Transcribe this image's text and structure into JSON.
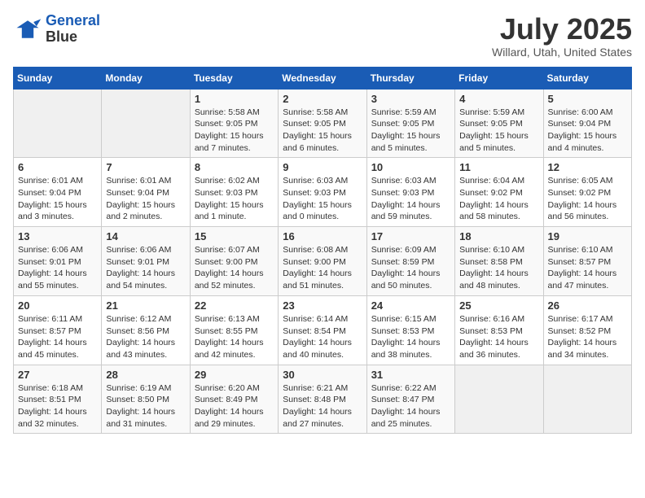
{
  "header": {
    "logo_line1": "General",
    "logo_line2": "Blue",
    "month_year": "July 2025",
    "location": "Willard, Utah, United States"
  },
  "weekdays": [
    "Sunday",
    "Monday",
    "Tuesday",
    "Wednesday",
    "Thursday",
    "Friday",
    "Saturday"
  ],
  "weeks": [
    [
      {
        "day": "",
        "content": ""
      },
      {
        "day": "",
        "content": ""
      },
      {
        "day": "1",
        "content": "Sunrise: 5:58 AM\nSunset: 9:05 PM\nDaylight: 15 hours\nand 7 minutes."
      },
      {
        "day": "2",
        "content": "Sunrise: 5:58 AM\nSunset: 9:05 PM\nDaylight: 15 hours\nand 6 minutes."
      },
      {
        "day": "3",
        "content": "Sunrise: 5:59 AM\nSunset: 9:05 PM\nDaylight: 15 hours\nand 5 minutes."
      },
      {
        "day": "4",
        "content": "Sunrise: 5:59 AM\nSunset: 9:05 PM\nDaylight: 15 hours\nand 5 minutes."
      },
      {
        "day": "5",
        "content": "Sunrise: 6:00 AM\nSunset: 9:04 PM\nDaylight: 15 hours\nand 4 minutes."
      }
    ],
    [
      {
        "day": "6",
        "content": "Sunrise: 6:01 AM\nSunset: 9:04 PM\nDaylight: 15 hours\nand 3 minutes."
      },
      {
        "day": "7",
        "content": "Sunrise: 6:01 AM\nSunset: 9:04 PM\nDaylight: 15 hours\nand 2 minutes."
      },
      {
        "day": "8",
        "content": "Sunrise: 6:02 AM\nSunset: 9:03 PM\nDaylight: 15 hours\nand 1 minute."
      },
      {
        "day": "9",
        "content": "Sunrise: 6:03 AM\nSunset: 9:03 PM\nDaylight: 15 hours\nand 0 minutes."
      },
      {
        "day": "10",
        "content": "Sunrise: 6:03 AM\nSunset: 9:03 PM\nDaylight: 14 hours\nand 59 minutes."
      },
      {
        "day": "11",
        "content": "Sunrise: 6:04 AM\nSunset: 9:02 PM\nDaylight: 14 hours\nand 58 minutes."
      },
      {
        "day": "12",
        "content": "Sunrise: 6:05 AM\nSunset: 9:02 PM\nDaylight: 14 hours\nand 56 minutes."
      }
    ],
    [
      {
        "day": "13",
        "content": "Sunrise: 6:06 AM\nSunset: 9:01 PM\nDaylight: 14 hours\nand 55 minutes."
      },
      {
        "day": "14",
        "content": "Sunrise: 6:06 AM\nSunset: 9:01 PM\nDaylight: 14 hours\nand 54 minutes."
      },
      {
        "day": "15",
        "content": "Sunrise: 6:07 AM\nSunset: 9:00 PM\nDaylight: 14 hours\nand 52 minutes."
      },
      {
        "day": "16",
        "content": "Sunrise: 6:08 AM\nSunset: 9:00 PM\nDaylight: 14 hours\nand 51 minutes."
      },
      {
        "day": "17",
        "content": "Sunrise: 6:09 AM\nSunset: 8:59 PM\nDaylight: 14 hours\nand 50 minutes."
      },
      {
        "day": "18",
        "content": "Sunrise: 6:10 AM\nSunset: 8:58 PM\nDaylight: 14 hours\nand 48 minutes."
      },
      {
        "day": "19",
        "content": "Sunrise: 6:10 AM\nSunset: 8:57 PM\nDaylight: 14 hours\nand 47 minutes."
      }
    ],
    [
      {
        "day": "20",
        "content": "Sunrise: 6:11 AM\nSunset: 8:57 PM\nDaylight: 14 hours\nand 45 minutes."
      },
      {
        "day": "21",
        "content": "Sunrise: 6:12 AM\nSunset: 8:56 PM\nDaylight: 14 hours\nand 43 minutes."
      },
      {
        "day": "22",
        "content": "Sunrise: 6:13 AM\nSunset: 8:55 PM\nDaylight: 14 hours\nand 42 minutes."
      },
      {
        "day": "23",
        "content": "Sunrise: 6:14 AM\nSunset: 8:54 PM\nDaylight: 14 hours\nand 40 minutes."
      },
      {
        "day": "24",
        "content": "Sunrise: 6:15 AM\nSunset: 8:53 PM\nDaylight: 14 hours\nand 38 minutes."
      },
      {
        "day": "25",
        "content": "Sunrise: 6:16 AM\nSunset: 8:53 PM\nDaylight: 14 hours\nand 36 minutes."
      },
      {
        "day": "26",
        "content": "Sunrise: 6:17 AM\nSunset: 8:52 PM\nDaylight: 14 hours\nand 34 minutes."
      }
    ],
    [
      {
        "day": "27",
        "content": "Sunrise: 6:18 AM\nSunset: 8:51 PM\nDaylight: 14 hours\nand 32 minutes."
      },
      {
        "day": "28",
        "content": "Sunrise: 6:19 AM\nSunset: 8:50 PM\nDaylight: 14 hours\nand 31 minutes."
      },
      {
        "day": "29",
        "content": "Sunrise: 6:20 AM\nSunset: 8:49 PM\nDaylight: 14 hours\nand 29 minutes."
      },
      {
        "day": "30",
        "content": "Sunrise: 6:21 AM\nSunset: 8:48 PM\nDaylight: 14 hours\nand 27 minutes."
      },
      {
        "day": "31",
        "content": "Sunrise: 6:22 AM\nSunset: 8:47 PM\nDaylight: 14 hours\nand 25 minutes."
      },
      {
        "day": "",
        "content": ""
      },
      {
        "day": "",
        "content": ""
      }
    ]
  ]
}
